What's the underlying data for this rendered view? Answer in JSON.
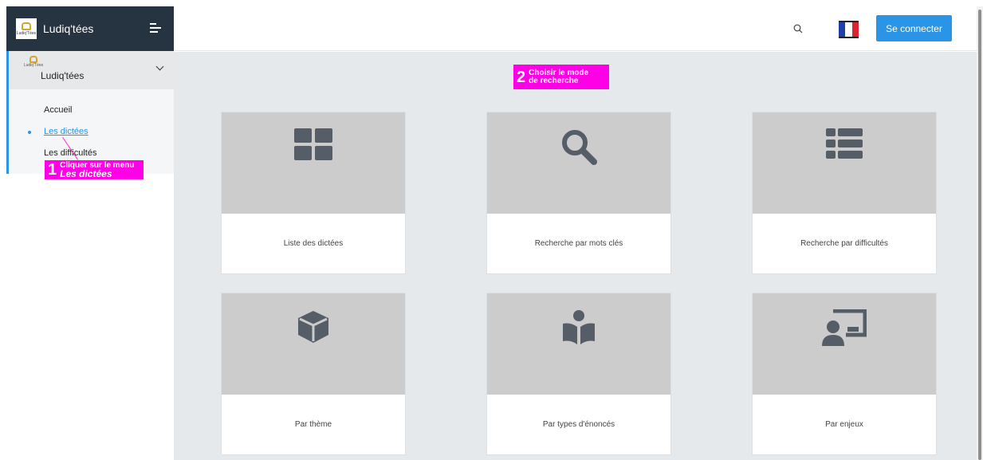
{
  "brand": {
    "title": "Ludiq'tées",
    "logo_text": "Ludiq'Tées"
  },
  "header": {
    "login_label": "Se connecter"
  },
  "sidebar": {
    "group_title": "Ludiq'tées",
    "group_logo_text": "Ludiq'Tées",
    "items": [
      {
        "label": "Accueil"
      },
      {
        "label": "Les dictées"
      },
      {
        "label": "Les difficultés"
      }
    ]
  },
  "annotations": {
    "step1": {
      "number": "1",
      "line1": "Cliquer sur le menu",
      "line2": "Les dictées"
    },
    "step2": {
      "number": "2",
      "line1": "Choisir le mode",
      "line2": "de recherche"
    }
  },
  "cards": [
    {
      "label": "Liste des dictées",
      "icon": "grid-icon"
    },
    {
      "label": "Recherche par mots clés",
      "icon": "search-icon"
    },
    {
      "label": "Recherche par difficultés",
      "icon": "list-icon"
    },
    {
      "label": "Par thème",
      "icon": "cube-icon"
    },
    {
      "label": "Par types d'énoncés",
      "icon": "reader-icon"
    },
    {
      "label": "Par enjeux",
      "icon": "presenter-icon"
    }
  ],
  "colors": {
    "accent": "#2a94e6",
    "sidebar_dark": "#263340",
    "annotation": "#ff00e6",
    "tile": "#cccccc",
    "icon": "#555d66"
  }
}
